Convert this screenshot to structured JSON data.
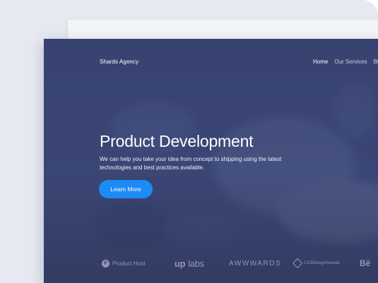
{
  "site": {
    "brand": "Shards Agency",
    "nav": [
      "Home",
      "Our Services",
      "Bl"
    ],
    "hero": {
      "title": "Product Development",
      "subtitle": "We can help you take your idea from concept to shipping using the latest technologies and best practices available.",
      "cta": "Learn More"
    },
    "logos": {
      "product_hunt": "Product Hunt",
      "product_hunt_mark": "P",
      "uplabs_a": "up",
      "uplabs_b": "labs",
      "awwwards": "AWWWARDS",
      "css_design_awards": "CSSDesignAwards",
      "behance": "Bē"
    }
  },
  "colors": {
    "overlay": "#3a4470",
    "cta": "#1d8bf5",
    "card": "#e6e9f1"
  }
}
